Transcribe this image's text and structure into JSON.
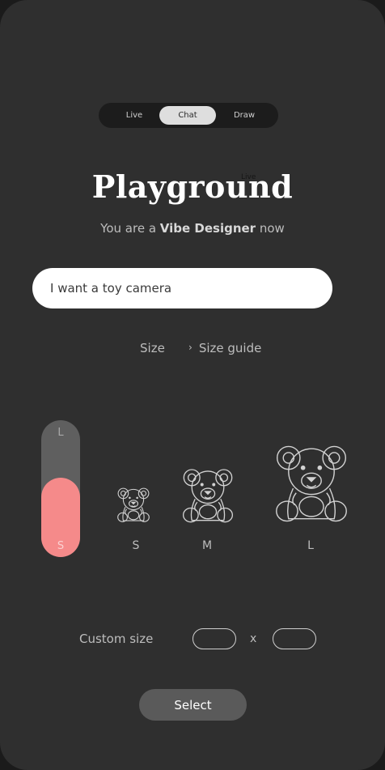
{
  "mode_tabs": [
    {
      "label": "Live",
      "active": false
    },
    {
      "label": "Chat",
      "active": true
    },
    {
      "label": "Draw",
      "active": false
    }
  ],
  "header": {
    "title": "Playground",
    "badge": "Live",
    "subtitle_pre": "You are a ",
    "subtitle_bold": "Vibe Designer",
    "subtitle_post": " now"
  },
  "prompt": {
    "value": "I want a toy camera"
  },
  "size_section": {
    "label": "Size",
    "guide_label": "Size guide",
    "chevron_icon": "chevron-right-icon"
  },
  "size_slider": {
    "top_label": "L",
    "bottom_label": "S",
    "level_percent": 58
  },
  "size_options": [
    {
      "label": "S",
      "icon": "teddy-bear-icon"
    },
    {
      "label": "M",
      "icon": "teddy-bear-icon"
    },
    {
      "label": "L",
      "icon": "teddy-bear-icon"
    }
  ],
  "custom_size": {
    "label": "Custom size",
    "separator": "x",
    "width_value": "",
    "height_value": ""
  },
  "select_button": {
    "label": "Select"
  },
  "colors": {
    "background": "#2f2f2f",
    "accent": "#f58a8a",
    "button": "#5a5a5a"
  }
}
